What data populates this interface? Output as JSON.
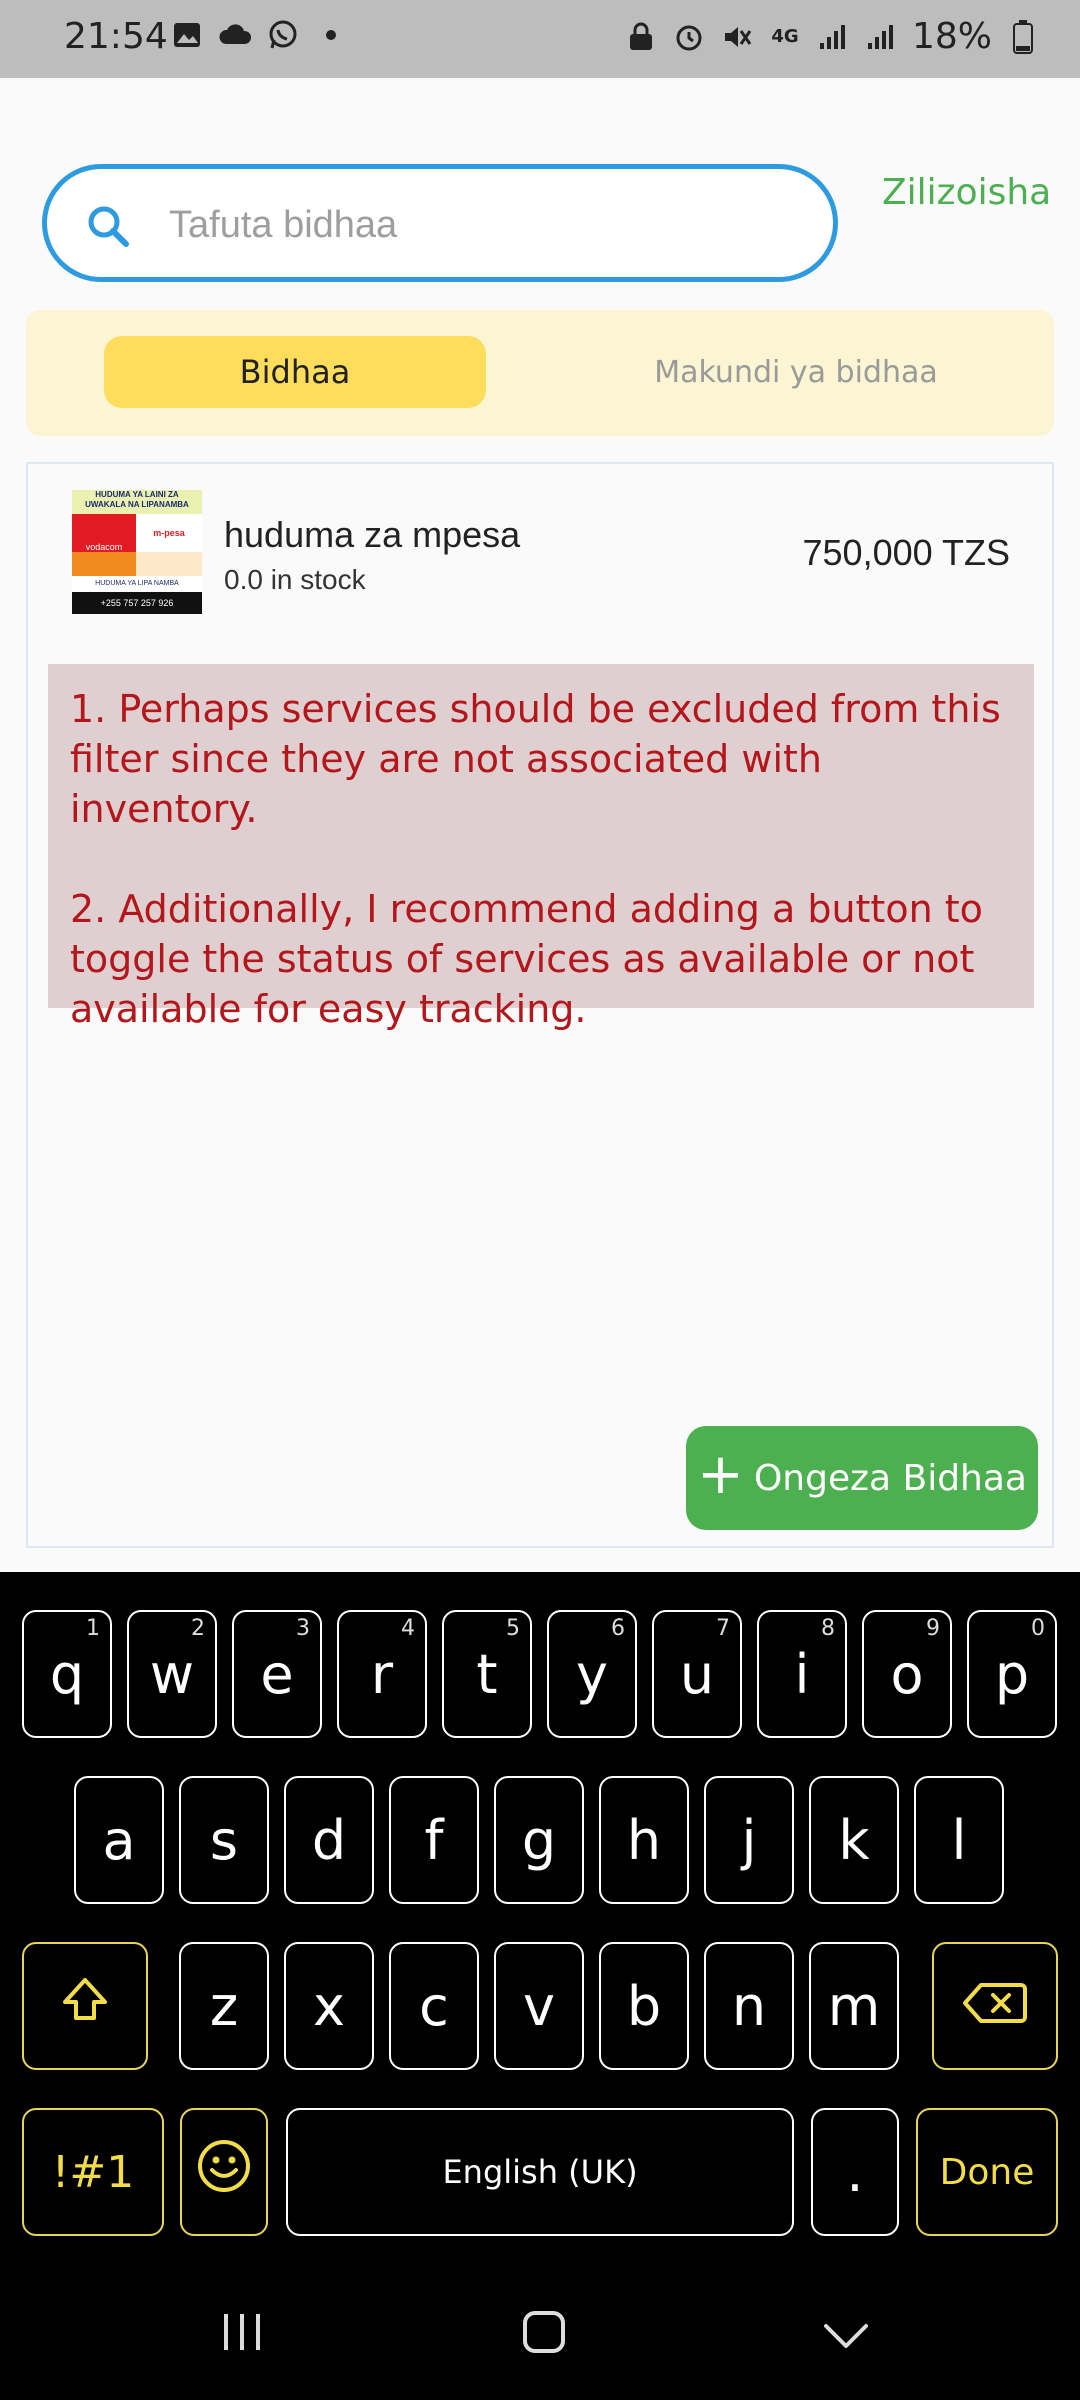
{
  "status_bar": {
    "time": "21:54",
    "battery": "18%",
    "network": "4G",
    "icons_left": [
      "image-icon",
      "cloud-icon",
      "whatsapp-icon",
      "dot-icon"
    ],
    "icons_right": [
      "lock-icon",
      "alarm-icon",
      "mute-icon",
      "network-4g-icon",
      "signal-icon",
      "signal-icon",
      "battery-icon"
    ]
  },
  "search": {
    "placeholder": "Tafuta bidhaa",
    "value": ""
  },
  "header": {
    "sold_out_link": "Zilizoisha"
  },
  "tabs": [
    {
      "label": "Bidhaa",
      "active": true
    },
    {
      "label": "Makundi ya bidhaa",
      "active": false
    }
  ],
  "products": [
    {
      "name": "huduma za mpesa",
      "stock": "0.0 in stock",
      "price": "750,000 TZS",
      "thumbnail_text": [
        "HUDUMA YA LAINI ZA",
        "UWAKALA NA LIPANAMBA",
        "vodacom",
        "m-pesa",
        "HUDUMA YA LIPA NAMBA",
        "+255 757 257 926"
      ]
    }
  ],
  "note": {
    "line1": "1. Perhaps services should be excluded from this filter since they are not associated with inventory.",
    "line2": "2. Additionally, I recommend adding a button to toggle the status of services as available or not available for easy tracking."
  },
  "fab": {
    "label": "Ongeza Bidhaa"
  },
  "keyboard": {
    "row1": [
      {
        "key": "q",
        "hint": "1"
      },
      {
        "key": "w",
        "hint": "2"
      },
      {
        "key": "e",
        "hint": "3"
      },
      {
        "key": "r",
        "hint": "4"
      },
      {
        "key": "t",
        "hint": "5"
      },
      {
        "key": "y",
        "hint": "6"
      },
      {
        "key": "u",
        "hint": "7"
      },
      {
        "key": "i",
        "hint": "8"
      },
      {
        "key": "o",
        "hint": "9"
      },
      {
        "key": "p",
        "hint": "0"
      }
    ],
    "row2": [
      "a",
      "s",
      "d",
      "f",
      "g",
      "h",
      "j",
      "k",
      "l"
    ],
    "row3": [
      "z",
      "x",
      "c",
      "v",
      "b",
      "n",
      "m"
    ],
    "symbols_label": "!#1",
    "space_label": "English (UK)",
    "period_label": ".",
    "done_label": "Done"
  },
  "colors": {
    "accent_blue": "#2e9be0",
    "green": "#4caf50",
    "tab_yellow": "#ffdd5c",
    "note_red": "#b3161b"
  }
}
